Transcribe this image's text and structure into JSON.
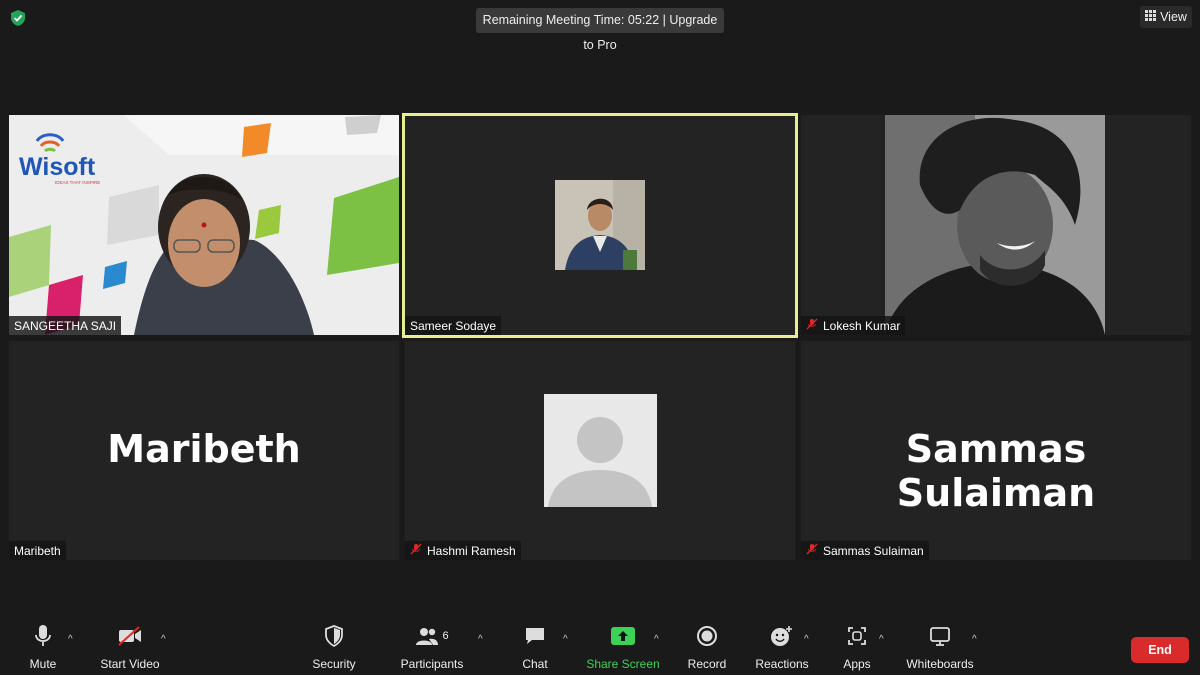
{
  "top_bar": {
    "timer_text": "Remaining Meeting Time: 05:22 | Upgrade to Pro",
    "view_label": "View"
  },
  "tiles": [
    {
      "name": "SANGEETHA SAJI",
      "muted": false,
      "logo_text": "Wisoft",
      "logo_tagline": "IDEAS THAT INSPIRE"
    },
    {
      "name": "Sameer Sodaye",
      "muted": false,
      "active_speaker": true
    },
    {
      "name": "Lokesh Kumar",
      "muted": true
    },
    {
      "name": "Maribeth",
      "muted": false,
      "display_text": "Maribeth"
    },
    {
      "name": "Hashmi Ramesh",
      "muted": true
    },
    {
      "name": "Sammas Sulaiman",
      "muted": true,
      "display_text": "Sammas Sulaiman"
    }
  ],
  "toolbar": {
    "mute": "Mute",
    "start_video": "Start Video",
    "security": "Security",
    "participants": "Participants",
    "participants_count": "6",
    "chat": "Chat",
    "share_screen": "Share Screen",
    "record": "Record",
    "reactions": "Reactions",
    "apps": "Apps",
    "whiteboards": "Whiteboards",
    "end": "End"
  },
  "colors": {
    "background": "#1a1a1a",
    "tile_bg": "#232323",
    "active_speaker_border": "#e9ef8f",
    "share_green": "#3ed158",
    "end_red": "#d92b2b",
    "muted_red": "#e02828"
  }
}
